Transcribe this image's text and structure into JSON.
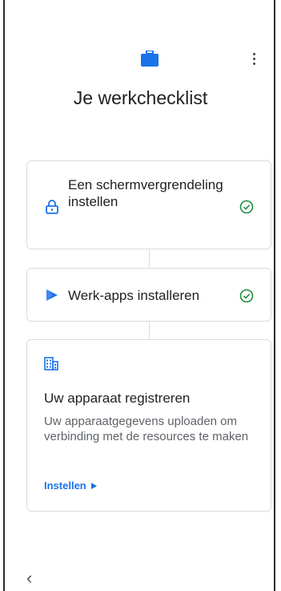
{
  "header": {
    "title": "Je werkchecklist",
    "icon": "briefcase-icon",
    "menu_icon": "more-vert-icon"
  },
  "colors": {
    "accent": "#1a73e8",
    "success": "#1e8e3e",
    "secondary_text": "#5f6368"
  },
  "checklist": {
    "step1": {
      "label": "Een schermvergrendeling instellen",
      "icon": "lock-icon",
      "status": "done"
    },
    "step2": {
      "label": "Werk-apps installeren",
      "icon": "play-store-icon",
      "status": "done"
    },
    "step3": {
      "icon": "building-icon",
      "title": "Uw apparaat registreren",
      "description": "Uw apparaatgegevens uploaden om verbinding met de resources te maken",
      "action_label": "Instellen",
      "status": "pending"
    }
  },
  "nav": {
    "back_glyph": "‹"
  }
}
